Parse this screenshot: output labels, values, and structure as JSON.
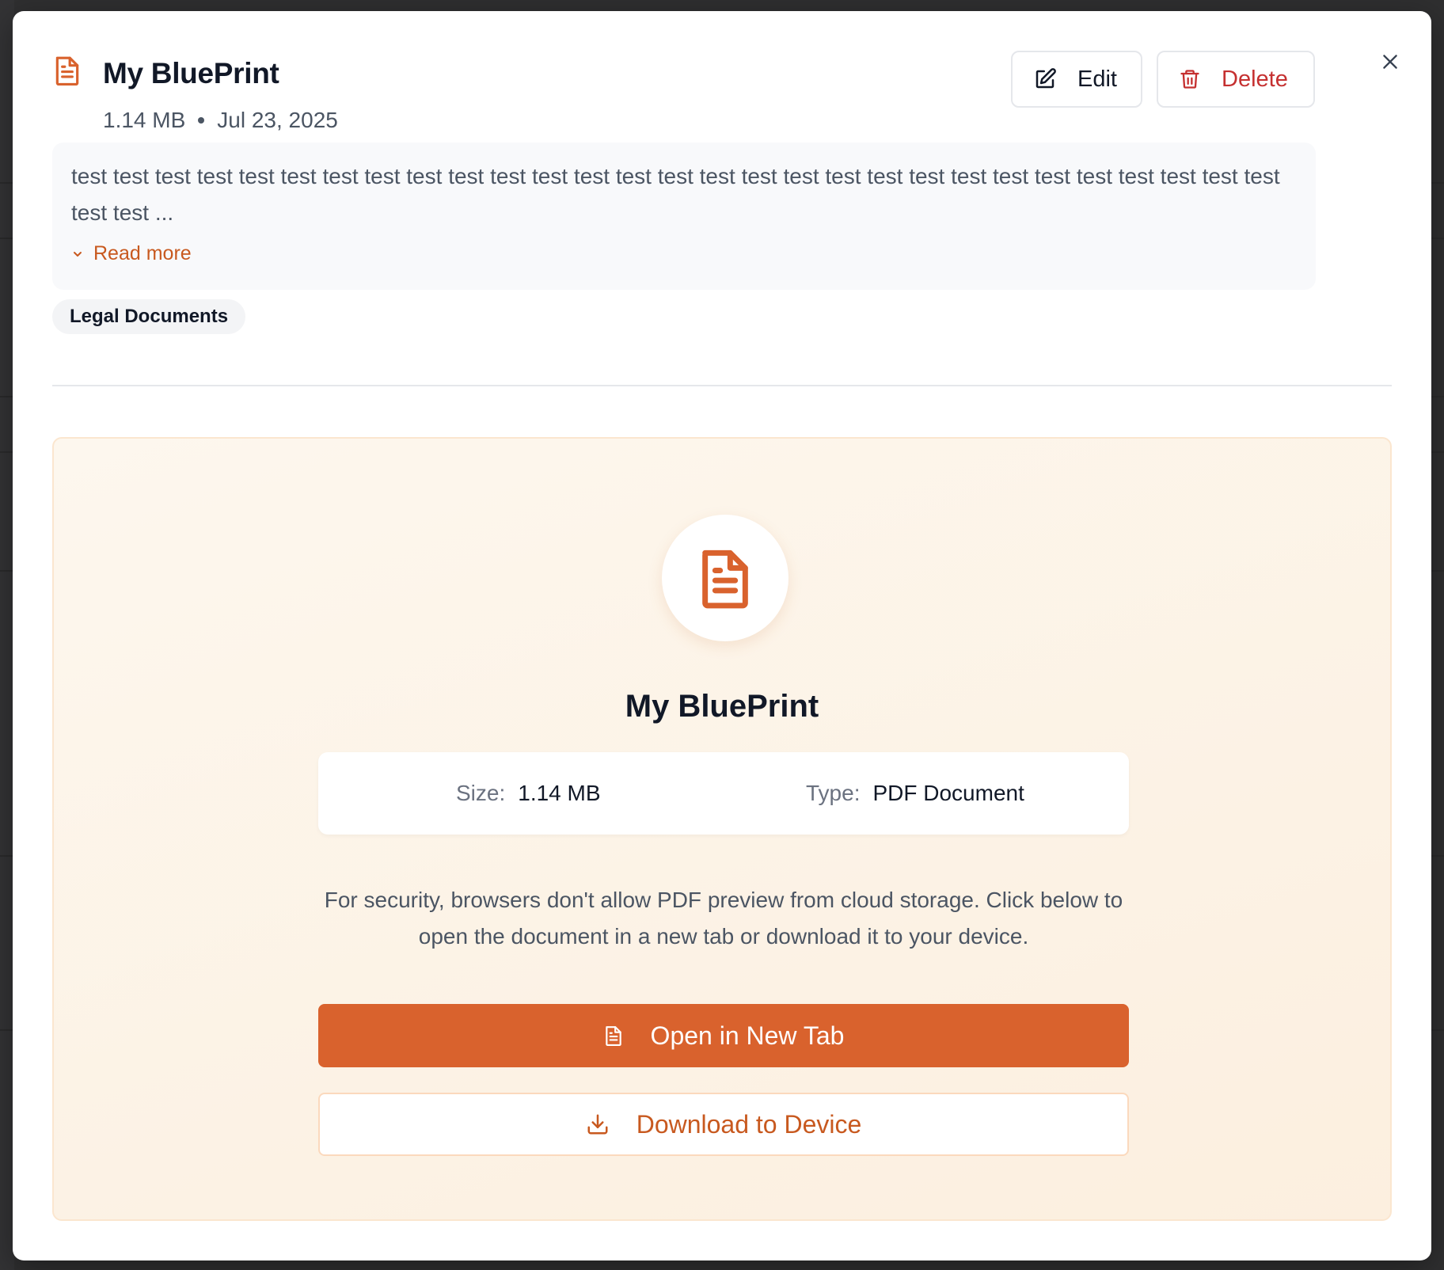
{
  "document": {
    "title": "My BluePrint",
    "size": "1.14 MB",
    "date": "Jul 23, 2025",
    "description": "test test test test test test test test test test test test test test test test test test test test test test test test test test test test test test test ...",
    "read_more_label": "Read more",
    "tag": "Legal Documents"
  },
  "actions": {
    "edit_label": "Edit",
    "delete_label": "Delete"
  },
  "preview": {
    "title": "My BluePrint",
    "size_label": "Size:",
    "size_value": "1.14 MB",
    "type_label": "Type:",
    "type_value": "PDF Document",
    "note": "For security, browsers don't allow PDF preview from cloud storage. Click below to open the document in a new tab or download it to your device.",
    "open_label": "Open in New Tab",
    "download_label": "Download to Device"
  },
  "colors": {
    "accent": "#d9622d",
    "danger": "#c53030",
    "preview_bg": "#fdf5ea"
  },
  "icons": {
    "header_doc": "file-text-icon",
    "edit": "edit-icon",
    "delete": "trash-icon",
    "close": "close-icon",
    "read_more": "chevron-down-icon",
    "open": "file-text-icon",
    "download": "download-icon"
  }
}
